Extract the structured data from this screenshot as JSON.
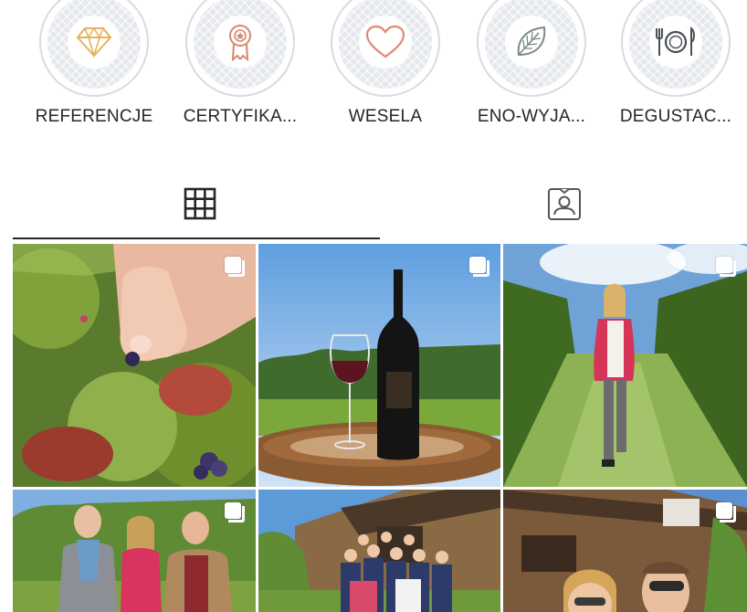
{
  "highlights": [
    {
      "label": "REFERENCJE",
      "icon": "diamond-icon",
      "color": "#e8b25b"
    },
    {
      "label": "CERTYFIKA...",
      "icon": "award-ribbon-icon",
      "color": "#d98670"
    },
    {
      "label": "WESELA",
      "icon": "heart-icon",
      "color": "#e08a74"
    },
    {
      "label": "ENO-WYJA...",
      "icon": "leaf-icon",
      "color": "#7a8a86"
    },
    {
      "label": "DEGUSTAC...",
      "icon": "cutlery-plate-icon",
      "color": "#4a4f55"
    }
  ],
  "tabs": [
    {
      "name": "posts-grid",
      "icon": "grid-icon",
      "selected": true
    },
    {
      "name": "tagged",
      "icon": "tagged-person-icon",
      "selected": false
    }
  ],
  "posts": [
    {
      "subject": "hand picking grapes in vineyard",
      "multi": true
    },
    {
      "subject": "wine bottle and glass on barrel",
      "multi": true
    },
    {
      "subject": "woman in red jacket walking in vineyard",
      "multi": true
    },
    {
      "subject": "three people holding wine",
      "multi": true
    },
    {
      "subject": "group photo in front of wooden house",
      "multi": false
    },
    {
      "subject": "selfie with sunglasses by wooden house",
      "multi": true
    }
  ],
  "colors": {
    "text": "#262626",
    "border": "#dbdbdb",
    "highlight_bg": "#e4e7ec"
  }
}
